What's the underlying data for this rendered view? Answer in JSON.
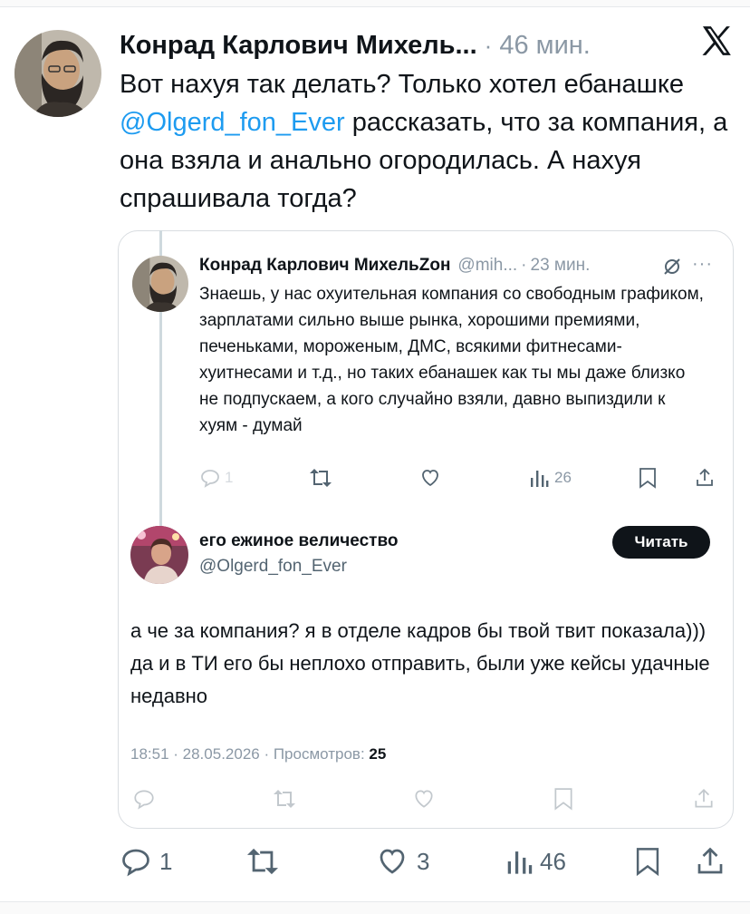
{
  "colors": {
    "accent": "#1d9bf0",
    "text": "#0f1419",
    "muted": "#8b98a5",
    "border": "#d9dde1"
  },
  "tweet": {
    "author_name": "Конрад Карлович Михель...",
    "time": "46 мин.",
    "text_before": "Вот нахуя так делать? Только хотел ебанашке ",
    "mention": "@Olgerd_fon_Ever",
    "text_after": " рассказать, что за компания, а она взяла и анально огородилась. А нахуя спрашивала тогда?",
    "icon": "x-logo-icon",
    "actions": {
      "replies": "1",
      "likes": "3",
      "views": "46"
    }
  },
  "quoted": {
    "author_name": "Конрад Карлович МихельZон",
    "handle": "@mih...",
    "time": "23 мин.",
    "more": "···",
    "text": "Знаешь, у нас охуительная компания со свободным графиком, зарплатами сильно выше рынка, хорошими премиями, печеньками, мороженым, ДМС, всякими фитнесами-хуитнесами и т.д., но таких ебанашек как ты мы даже близко не подпускаем, а кого случайно взяли, давно выпиздили к хуям - думай",
    "actions": {
      "replies": "1",
      "views": "26"
    }
  },
  "reply": {
    "author_name": "его ежиное величество",
    "handle": "@Olgerd_fon_Ever",
    "follow_label": "Читать",
    "text": "а че за компания? я в отделе кадров бы твой твит показала))) да и в ТИ его бы неплохо отправить, были уже кейсы удачные недавно",
    "meta_prefix": "18:51 · 28.05.2026 · Просмотров: ",
    "views": "25"
  }
}
